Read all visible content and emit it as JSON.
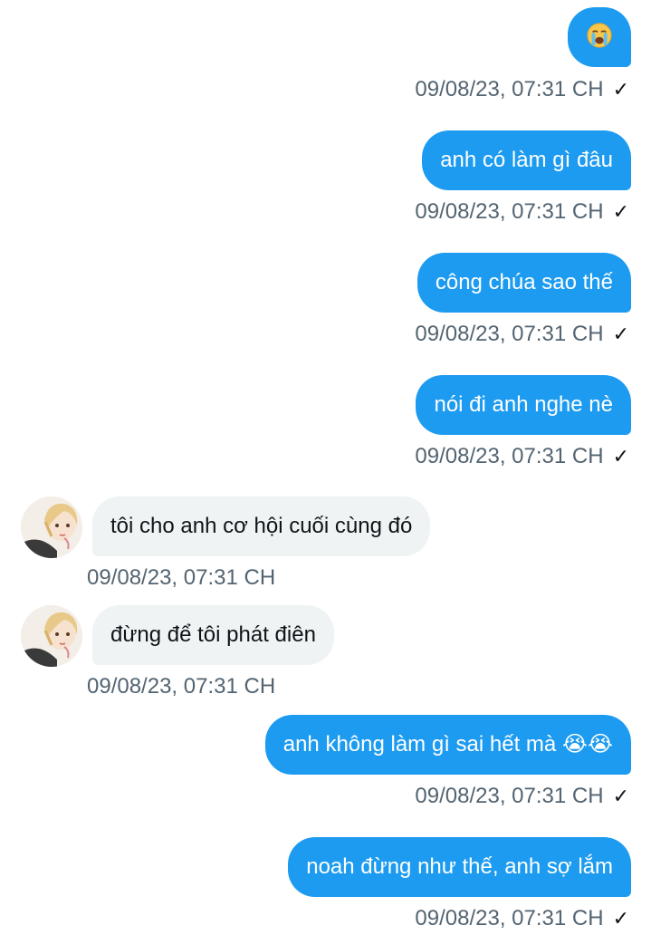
{
  "messages": [
    {
      "side": "sent",
      "text": "😭",
      "time": "09/08/23, 07:31 CH"
    },
    {
      "side": "sent",
      "text": "anh có làm gì đâu",
      "time": "09/08/23, 07:31 CH"
    },
    {
      "side": "sent",
      "text": "công chúa sao thế",
      "time": "09/08/23, 07:31 CH"
    },
    {
      "side": "sent",
      "text": "nói đi anh nghe nè",
      "time": "09/08/23, 07:31 CH"
    },
    {
      "side": "received",
      "text": "tôi cho anh cơ hội cuối cùng đó",
      "time": "09/08/23, 07:31 CH"
    },
    {
      "side": "received",
      "text": "đừng để tôi phát điên",
      "time": "09/08/23, 07:31 CH"
    },
    {
      "side": "sent",
      "text": "anh không làm gì sai hết mà 😭😭",
      "time": "09/08/23, 07:31 CH"
    },
    {
      "side": "sent",
      "text": "noah đừng như thế, anh sợ lắm",
      "time": "09/08/23, 07:31 CH"
    }
  ],
  "read_mark": "✓",
  "icons": {
    "read_receipt": "checkmark-icon",
    "emoji": "loudly-crying-face-icon",
    "avatar": "user-avatar"
  },
  "colors": {
    "sent_bubble": "#1d9bf0",
    "received_bubble": "#eff3f4",
    "timestamp": "#536471"
  }
}
